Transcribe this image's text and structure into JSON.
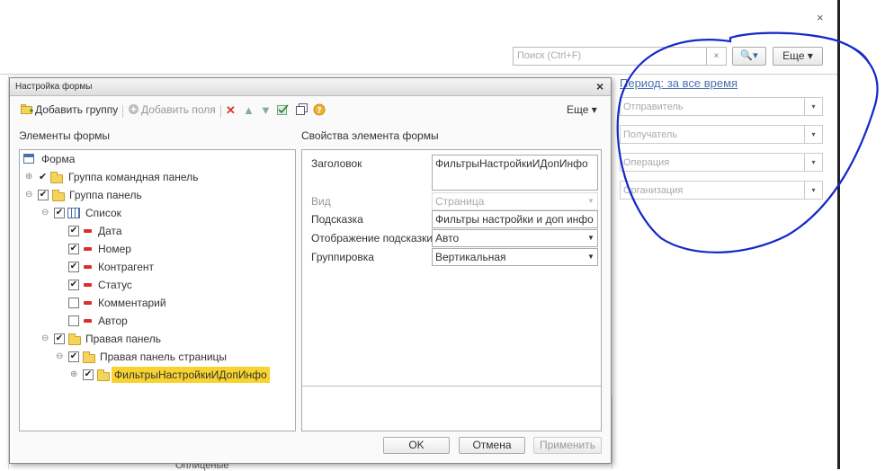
{
  "background": {
    "close_glyph": "×",
    "search": {
      "placeholder": "Поиск (Ctrl+F)",
      "clear_glyph": "×",
      "button_glyph": "🔍▾"
    },
    "more_button": "Еще ▾",
    "period_link": "Период: за все время",
    "filters": [
      {
        "placeholder": "Отправитель"
      },
      {
        "placeholder": "Получатель"
      },
      {
        "placeholder": "Операция"
      },
      {
        "placeholder": "Организация"
      }
    ],
    "dropdown_glyph": "▾",
    "bottom_text": "Оплиценые"
  },
  "dialog": {
    "title": "Настройка формы",
    "close_glyph": "×",
    "toolbar": {
      "add_group": "Добавить группу",
      "add_field": "Добавить поля",
      "more": "Еще ▾"
    },
    "left_header": "Элементы формы",
    "right_header": "Свойства элемента формы",
    "tree": [
      {
        "label": "Форма",
        "level": 0,
        "icon": "form-icon"
      },
      {
        "label": "Группа командная панель",
        "level": 1,
        "checked": true,
        "expander": "⊕"
      },
      {
        "label": "Группа панель",
        "level": 1,
        "checked": true,
        "expander": "⊖"
      },
      {
        "label": "Список",
        "level": 2,
        "checked": true,
        "expander": "⊖",
        "icon": "table-icon"
      },
      {
        "label": "Дата",
        "level": 3,
        "checked": true
      },
      {
        "label": "Номер",
        "level": 3,
        "checked": true
      },
      {
        "label": "Контрагент",
        "level": 3,
        "checked": true
      },
      {
        "label": "Статус",
        "level": 3,
        "checked": true
      },
      {
        "label": "Комментарий",
        "level": 3,
        "checked": false
      },
      {
        "label": "Автор",
        "level": 3,
        "checked": false
      },
      {
        "label": "Правая панель",
        "level": 2,
        "checked": true,
        "expander": "⊖"
      },
      {
        "label": "Правая панель страницы",
        "level": 3,
        "checked": true,
        "expander": "⊖"
      },
      {
        "label": "ФильтрыНастройкиИДопИнфо",
        "level": 4,
        "checked": true,
        "expander": "⊕",
        "selected": true
      }
    ],
    "properties": {
      "title_label": "Заголовок",
      "title_value": "ФильтрыНастройкиИДопИнфо",
      "view_label": "Вид",
      "view_value": "Страница",
      "hint_label": "Подсказка",
      "hint_value": "Фильтры настройки и доп инфо",
      "hint_display_label": "Отображение подсказки",
      "hint_display_value": "Авто",
      "grouping_label": "Группировка",
      "grouping_value": "Вертикальная"
    },
    "buttons": {
      "ok": "OK",
      "cancel": "Отмена",
      "apply": "Применить"
    }
  },
  "colors": {
    "selection": "#f8d330",
    "annotation": "#1428c8",
    "link": "#4b6fb0"
  }
}
